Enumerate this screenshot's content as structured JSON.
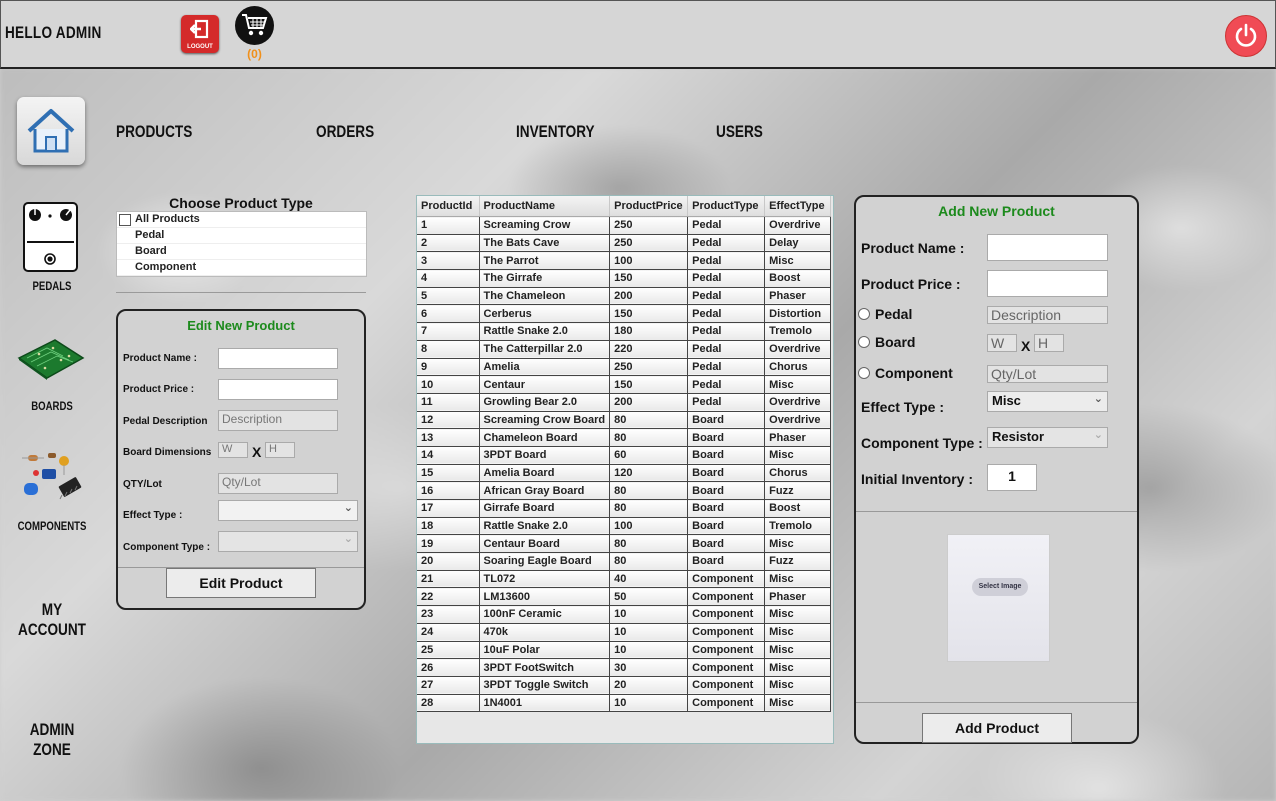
{
  "header": {
    "greeting": "HELLO ADMIN",
    "logout_label": "LOGOUT",
    "cart_count": "(0)"
  },
  "icons": {
    "logout": "logout-icon",
    "cart": "cart-icon",
    "power": "power-icon",
    "home": "home-icon",
    "pedal": "pedal-icon",
    "board": "circuit-board-icon",
    "components": "components-icon"
  },
  "nav": {
    "products": "PRODUCTS",
    "orders": "ORDERS",
    "inventory": "INVENTORY",
    "users": "USERS"
  },
  "sidebar": {
    "pedals": "PEDALS",
    "boards": "BOARDS",
    "components": "COMPONENTS",
    "my_account": "MY ACCOUNT",
    "admin_zone": "ADMIN ZONE"
  },
  "filter": {
    "title": "Choose Product Type",
    "items": [
      "All Products",
      "Pedal",
      "Board",
      "Component"
    ]
  },
  "edit": {
    "title": "Edit New Product",
    "product_name_label": "Product Name :",
    "product_price_label": "Product Price :",
    "pedal_desc_label": "Pedal Description",
    "pedal_desc_placeholder": "Description",
    "board_dim_label": "Board Dimensions",
    "w_placeholder": "W",
    "x_label": "X",
    "h_placeholder": "H",
    "qty_label": "QTY/Lot",
    "qty_placeholder": "Qty/Lot",
    "effect_type_label": "Effect Type :",
    "component_type_label": "Component Type :",
    "button": "Edit Product"
  },
  "table": {
    "columns": [
      "ProductId",
      "ProductName",
      "ProductPrice",
      "ProductType",
      "EffectType"
    ],
    "rows": [
      [
        "1",
        "Screaming Crow",
        "250",
        "Pedal",
        "Overdrive"
      ],
      [
        "2",
        "The Bats Cave",
        "250",
        "Pedal",
        "Delay"
      ],
      [
        "3",
        "The Parrot",
        "100",
        "Pedal",
        "Misc"
      ],
      [
        "4",
        "The Girrafe",
        "150",
        "Pedal",
        "Boost"
      ],
      [
        "5",
        "The Chameleon",
        "200",
        "Pedal",
        "Phaser"
      ],
      [
        "6",
        "Cerberus",
        "150",
        "Pedal",
        "Distortion"
      ],
      [
        "7",
        "Rattle Snake 2.0",
        "180",
        "Pedal",
        "Tremolo"
      ],
      [
        "8",
        "The Catterpillar 2.0",
        "220",
        "Pedal",
        "Overdrive"
      ],
      [
        "9",
        "Amelia",
        "250",
        "Pedal",
        "Chorus"
      ],
      [
        "10",
        "Centaur",
        "150",
        "Pedal",
        "Misc"
      ],
      [
        "11",
        "Growling Bear 2.0",
        "200",
        "Pedal",
        "Overdrive"
      ],
      [
        "12",
        "Screaming Crow Board",
        "80",
        "Board",
        "Overdrive"
      ],
      [
        "13",
        "Chameleon Board",
        "80",
        "Board",
        "Phaser"
      ],
      [
        "14",
        "3PDT Board",
        "60",
        "Board",
        "Misc"
      ],
      [
        "15",
        "Amelia Board",
        "120",
        "Board",
        "Chorus"
      ],
      [
        "16",
        "African Gray Board",
        "80",
        "Board",
        "Fuzz"
      ],
      [
        "17",
        "Girrafe Board",
        "80",
        "Board",
        "Boost"
      ],
      [
        "18",
        "Rattle Snake 2.0",
        "100",
        "Board",
        "Tremolo"
      ],
      [
        "19",
        "Centaur Board",
        "80",
        "Board",
        "Misc"
      ],
      [
        "20",
        "Soaring Eagle Board",
        "80",
        "Board",
        "Fuzz"
      ],
      [
        "21",
        "TL072",
        "40",
        "Component",
        "Misc"
      ],
      [
        "22",
        "LM13600",
        "50",
        "Component",
        "Phaser"
      ],
      [
        "23",
        "100nF Ceramic",
        "10",
        "Component",
        "Misc"
      ],
      [
        "24",
        "470k",
        "10",
        "Component",
        "Misc"
      ],
      [
        "25",
        "10uF Polar",
        "10",
        "Component",
        "Misc"
      ],
      [
        "26",
        "3PDT FootSwitch",
        "30",
        "Component",
        "Misc"
      ],
      [
        "27",
        "3PDT Toggle Switch",
        "20",
        "Component",
        "Misc"
      ],
      [
        "28",
        "1N4001",
        "10",
        "Component",
        "Misc"
      ]
    ]
  },
  "add": {
    "title": "Add New Product",
    "product_name_label": "Product Name :",
    "product_price_label": "Product Price :",
    "pedal_label": "Pedal",
    "desc_placeholder": "Description",
    "board_label": "Board",
    "w_placeholder": "W",
    "x_label": "X",
    "h_placeholder": "H",
    "component_label": "Component",
    "qty_placeholder": "Qty/Lot",
    "effect_type_label": "Effect Type :",
    "effect_type_value": "Misc",
    "component_type_label": "Component Type :",
    "component_type_value": "Resistor",
    "initial_inventory_label": "Initial Inventory :",
    "initial_inventory_value": "1",
    "select_image": "Select Image",
    "button": "Add Product"
  },
  "colors": {
    "panel_title": "#1c8a1c",
    "logout_red": "#d42a2a",
    "power_red": "#f04b55",
    "cart_count": "#f0901b"
  }
}
